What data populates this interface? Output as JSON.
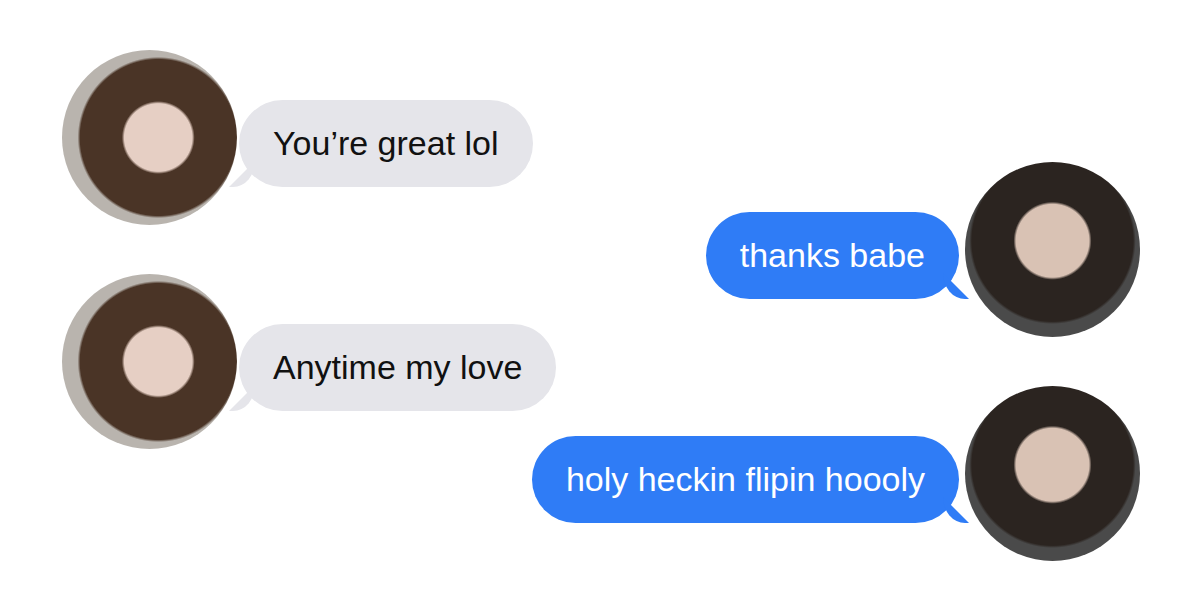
{
  "messages": [
    {
      "kind": "received",
      "text": "You’re great lol"
    },
    {
      "kind": "sent",
      "text": "thanks babe"
    },
    {
      "kind": "received",
      "text": "Anytime my love"
    },
    {
      "kind": "sent",
      "text": "holy heckin flipin hoooly"
    }
  ]
}
